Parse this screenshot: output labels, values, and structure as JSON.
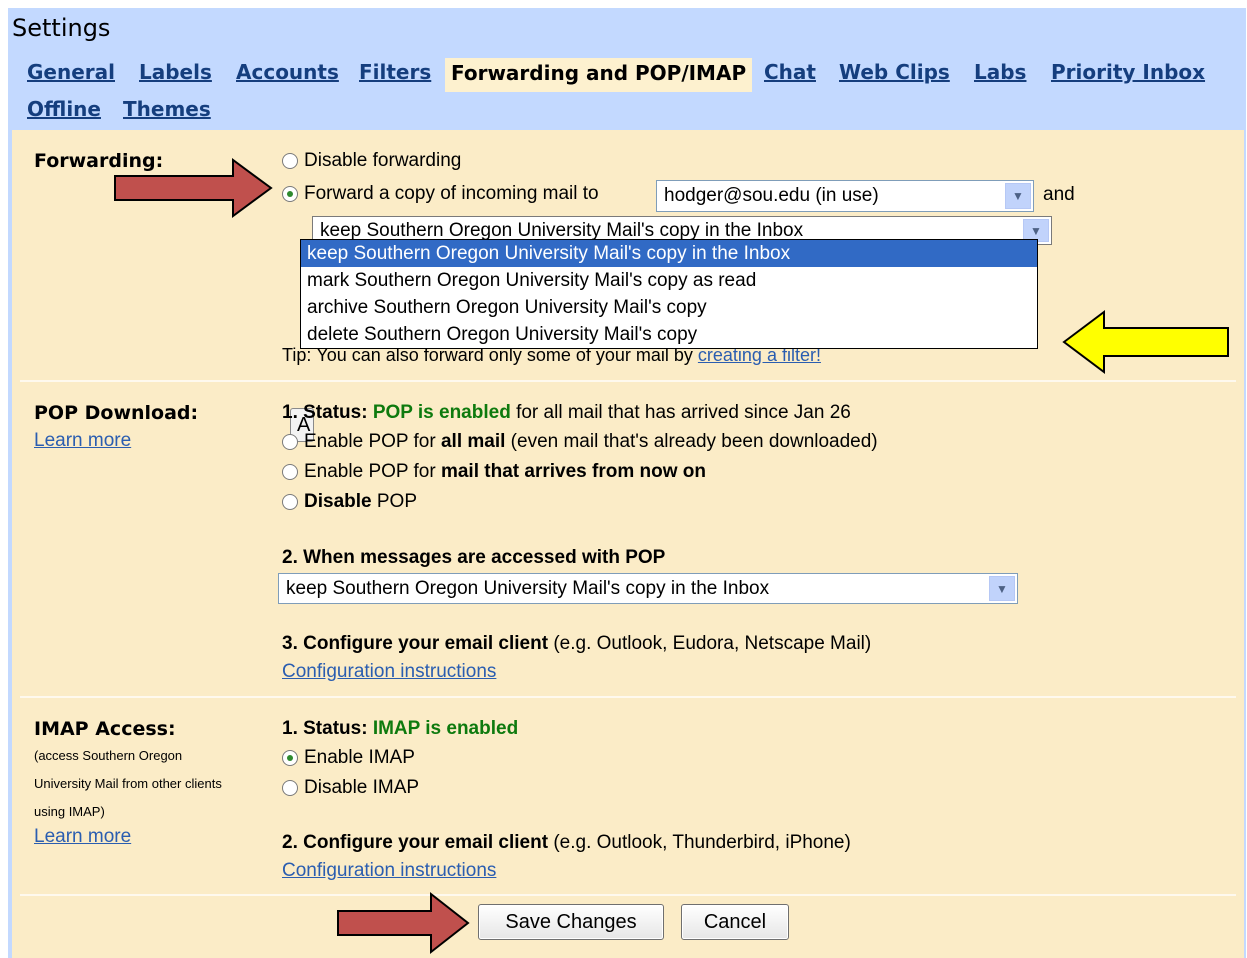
{
  "page_title": "Settings",
  "tabs": [
    {
      "label": "General"
    },
    {
      "label": "Labels"
    },
    {
      "label": "Accounts"
    },
    {
      "label": "Filters"
    },
    {
      "label": "Forwarding and POP/IMAP",
      "active": true
    },
    {
      "label": "Chat"
    },
    {
      "label": "Web Clips"
    },
    {
      "label": "Labs"
    },
    {
      "label": "Priority Inbox"
    },
    {
      "label": "Offline"
    },
    {
      "label": "Themes"
    }
  ],
  "forwarding": {
    "label": "Forwarding:",
    "disable_label": "Disable forwarding",
    "forward_label": "Forward a copy of incoming mail to",
    "forward_address": "hodger@sou.edu (in use)",
    "and_label": "and",
    "action_selected": "keep Southern Oregon University Mail's copy in the Inbox",
    "action_options": [
      "keep Southern Oregon University Mail's copy in the Inbox",
      "mark Southern Oregon University Mail's copy as read",
      "archive Southern Oregon University Mail's copy",
      "delete Southern Oregon University Mail's copy"
    ],
    "hidden_button_partial": "A",
    "tip_prefix": "Tip:",
    "tip_text": "You can also forward only some of your mail by",
    "tip_link": "creating a filter!"
  },
  "pop": {
    "label": "POP Download:",
    "learn_more": "Learn more",
    "status_prefix": "1. Status:",
    "status_value": "POP is enabled",
    "status_suffix": "for all mail that has arrived since Jan 26",
    "opt_all_prefix": "Enable POP for",
    "opt_all_bold": "all mail",
    "opt_all_suffix": "(even mail that's already been downloaded)",
    "opt_now_prefix": "Enable POP for",
    "opt_now_bold": "mail that arrives from now on",
    "opt_disable_bold": "Disable",
    "opt_disable_suffix": "POP",
    "when_heading": "2. When messages are accessed with POP",
    "when_selected": "keep Southern Oregon University Mail's copy in the Inbox",
    "configure_bold": "3. Configure your email client",
    "configure_suffix": "(e.g. Outlook, Eudora, Netscape Mail)",
    "config_link": "Configuration instructions"
  },
  "imap": {
    "label": "IMAP Access:",
    "sub_label": "(access Southern Oregon University Mail from other clients using IMAP)",
    "learn_more": "Learn more",
    "status_prefix": "1. Status:",
    "status_value": "IMAP is enabled",
    "enable_label": "Enable IMAP",
    "disable_label": "Disable IMAP",
    "configure_bold": "2. Configure your email client",
    "configure_suffix": "(e.g. Outlook, Thunderbird, iPhone)",
    "config_link": "Configuration instructions"
  },
  "buttons": {
    "save": "Save Changes",
    "cancel": "Cancel"
  },
  "annotations": {
    "red_arrow_color": "#c0504d",
    "yellow_arrow_color": "#ffff00"
  }
}
